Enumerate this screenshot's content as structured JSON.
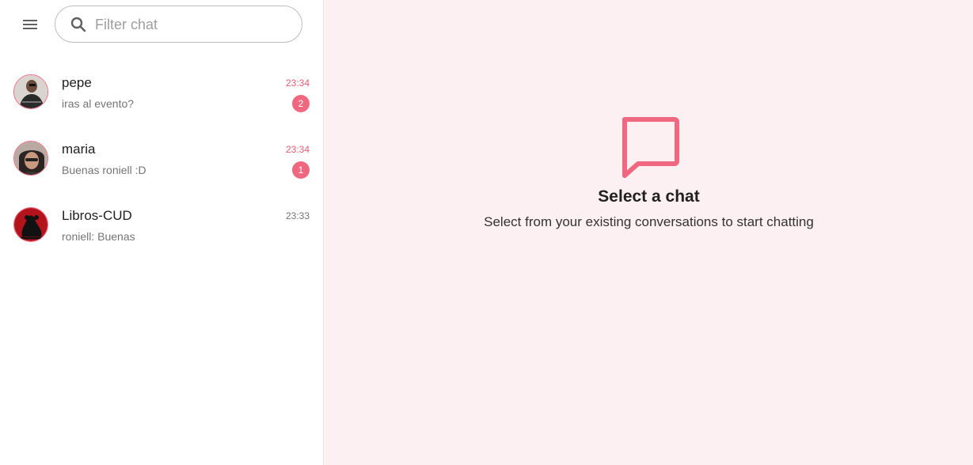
{
  "search": {
    "placeholder": "Filter chat"
  },
  "chats": [
    {
      "name": "pepe",
      "preview": "iras al evento?",
      "time": "23:34",
      "unread": "2"
    },
    {
      "name": "maria",
      "preview": "Buenas roniell :D",
      "time": "23:34",
      "unread": "1"
    },
    {
      "name": "Libros-CUD",
      "preview": "roniell: Buenas",
      "time": "23:33",
      "unread": ""
    }
  ],
  "empty_state": {
    "icon": "chat-bubble-icon",
    "title": "Select a chat",
    "subtitle": "Select from your existing conversations to start chatting"
  },
  "colors": {
    "accent": "#f06880",
    "main_bg": "#fdf0f3",
    "time_unread": "#e65b73"
  }
}
